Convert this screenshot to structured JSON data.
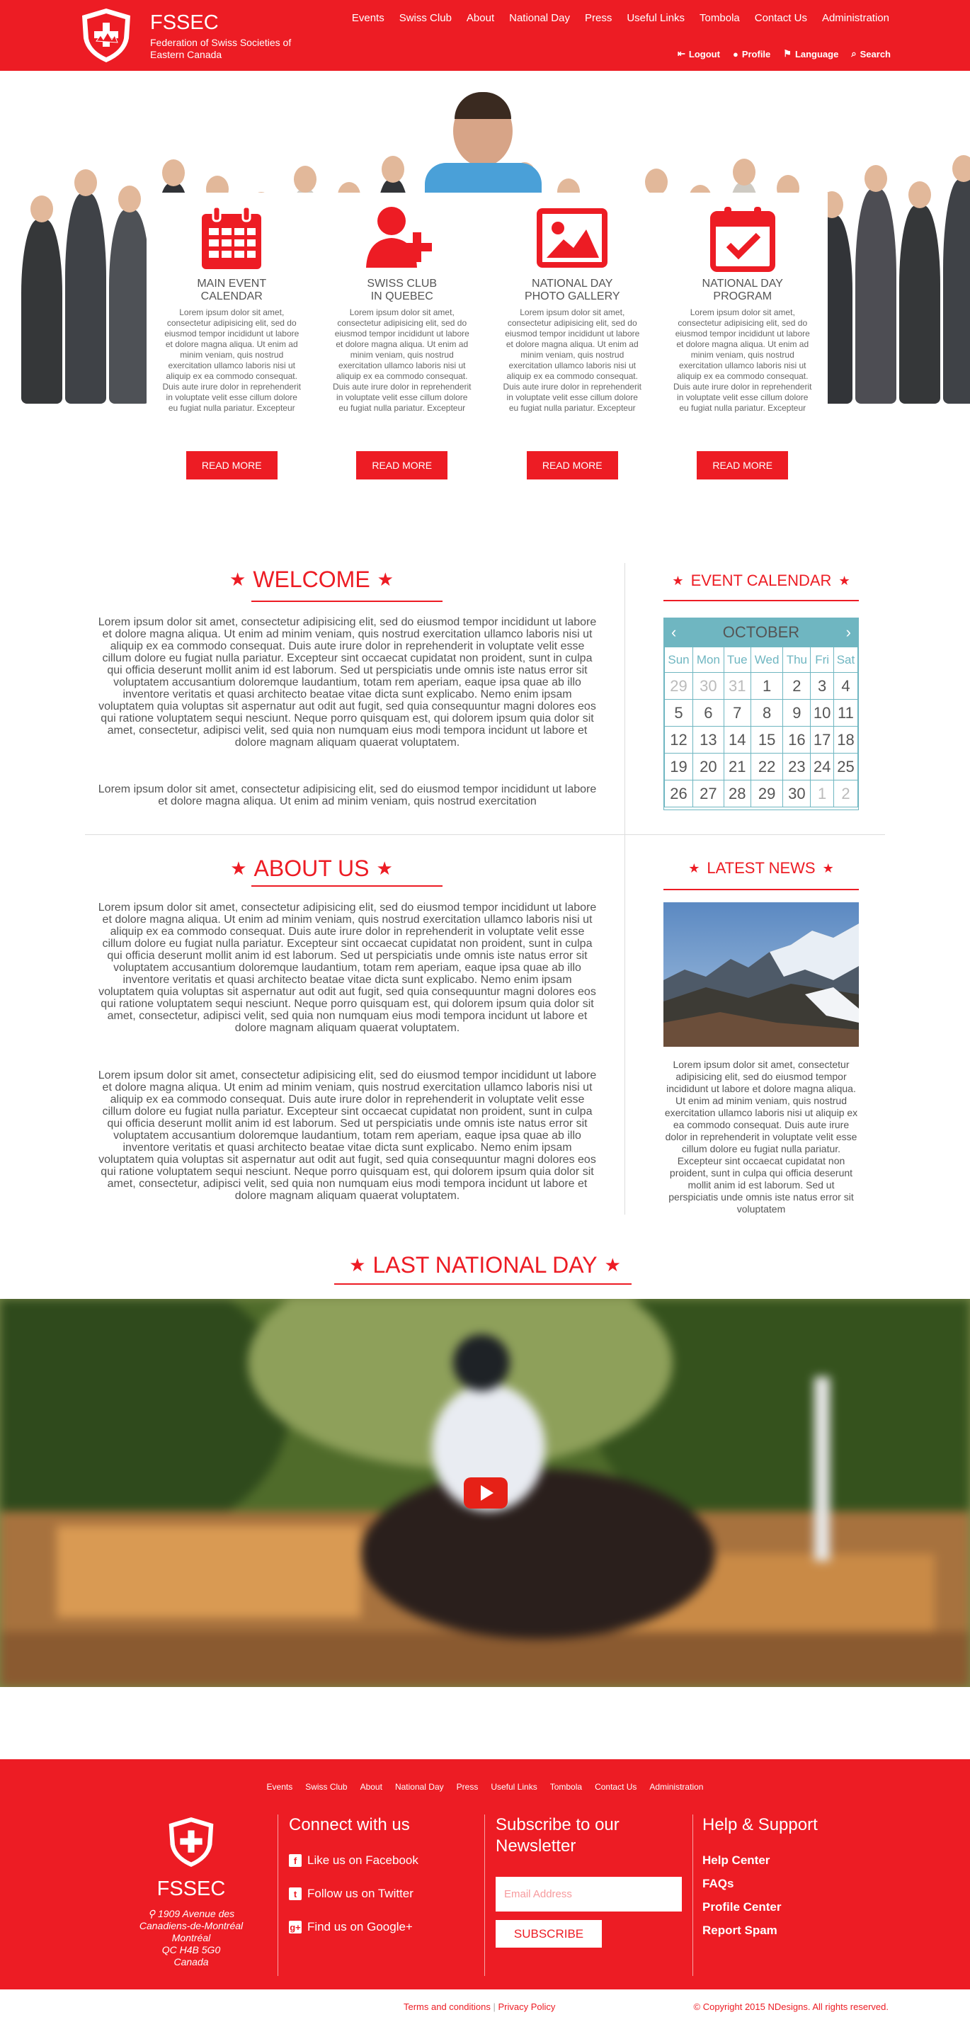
{
  "header": {
    "brand": "FSSEC",
    "subtitle": "Federation of Swiss Societies of Eastern Canada",
    "nav": [
      "Events",
      "Swiss Club",
      "About",
      "National Day",
      "Press",
      "Useful Links",
      "Tombola",
      "Contact Us",
      "Administration"
    ],
    "subnav": [
      {
        "icon": "logout-icon",
        "label": "Logout"
      },
      {
        "icon": "user-icon",
        "label": "Profile"
      },
      {
        "icon": "language-icon",
        "label": "Language"
      },
      {
        "icon": "search-icon",
        "label": "Search"
      }
    ]
  },
  "cards": [
    {
      "icon": "calendar-grid-icon",
      "title_l1": "MAIN EVENT",
      "title_l2": "CALENDAR",
      "text": "Lorem ipsum dolor sit amet, consectetur adipisicing elit, sed do eiusmod tempor incididunt ut labore et dolore magna aliqua. Ut enim ad minim veniam, quis nostrud exercitation ullamco laboris nisi ut aliquip ex ea commodo consequat. Duis aute irure dolor in reprehenderit in voluptate velit esse cillum dolore eu fugiat nulla pariatur. Excepteur",
      "button": "READ MORE"
    },
    {
      "icon": "add-user-icon",
      "title_l1": "SWISS CLUB",
      "title_l2": "IN QUEBEC",
      "text": "Lorem ipsum dolor sit amet, consectetur adipisicing elit, sed do eiusmod tempor incididunt ut labore et dolore magna aliqua. Ut enim ad minim veniam, quis nostrud exercitation ullamco laboris nisi ut aliquip ex ea commodo consequat. Duis aute irure dolor in reprehenderit in voluptate velit esse cillum dolore eu fugiat nulla pariatur. Excepteur",
      "button": "READ MORE"
    },
    {
      "icon": "picture-icon",
      "title_l1": "NATIONAL DAY",
      "title_l2": "PHOTO GALLERY",
      "text": "Lorem ipsum dolor sit amet, consectetur adipisicing elit, sed do eiusmod tempor incididunt ut labore et dolore magna aliqua. Ut enim ad minim veniam, quis nostrud exercitation ullamco laboris nisi ut aliquip ex ea commodo consequat. Duis aute irure dolor in reprehenderit in voluptate velit esse cillum dolore eu fugiat nulla pariatur. Excepteur",
      "button": "READ MORE"
    },
    {
      "icon": "calendar-check-icon",
      "title_l1": "NATIONAL DAY",
      "title_l2": "PROGRAM",
      "text": "Lorem ipsum dolor sit amet, consectetur adipisicing elit, sed do eiusmod tempor incididunt ut labore et dolore magna aliqua. Ut enim ad minim veniam, quis nostrud exercitation ullamco laboris nisi ut aliquip ex ea commodo consequat. Duis aute irure dolor in reprehenderit in voluptate velit esse cillum dolore eu fugiat nulla pariatur. Excepteur",
      "button": "READ MORE"
    }
  ],
  "welcome": {
    "title": "WELCOME",
    "p1": "Lorem ipsum dolor sit amet, consectetur adipisicing elit, sed do eiusmod tempor incididunt ut labore et dolore magna aliqua. Ut enim ad minim veniam, quis nostrud exercitation ullamco laboris nisi ut aliquip ex ea commodo consequat. Duis aute irure dolor in reprehenderit in voluptate velit esse cillum dolore eu fugiat nulla pariatur. Excepteur sint occaecat cupidatat non proident, sunt in culpa qui officia deserunt mollit anim id est laborum. Sed ut perspiciatis unde omnis iste natus error sit voluptatem accusantium doloremque laudantium, totam rem aperiam, eaque ipsa quae ab illo inventore veritatis et quasi architecto beatae vitae dicta sunt explicabo. Nemo enim ipsam voluptatem quia voluptas sit aspernatur aut odit aut fugit, sed quia consequuntur magni dolores eos qui ratione voluptatem sequi nesciunt. Neque porro quisquam est, qui dolorem ipsum quia dolor sit amet, consectetur, adipisci velit, sed quia non numquam eius modi tempora incidunt ut labore et dolore magnam aliquam quaerat voluptatem.",
    "p2": "Lorem ipsum dolor sit amet, consectetur adipisicing elit, sed do eiusmod tempor incididunt ut labore et dolore magna aliqua. Ut enim ad minim veniam, quis nostrud exercitation"
  },
  "calendar": {
    "title": "EVENT CALENDAR",
    "month": "OCTOBER",
    "weekdays": [
      "Sun",
      "Mon",
      "Tue",
      "Wed",
      "Thu",
      "Fri",
      "Sat"
    ],
    "rows": [
      [
        "29",
        "30",
        "31",
        "1",
        "2",
        "3",
        "4"
      ],
      [
        "5",
        "6",
        "7",
        "8",
        "9",
        "10",
        "11"
      ],
      [
        "12",
        "13",
        "14",
        "15",
        "16",
        "17",
        "18"
      ],
      [
        "19",
        "20",
        "21",
        "22",
        "23",
        "24",
        "25"
      ],
      [
        "26",
        "27",
        "28",
        "29",
        "30",
        "1",
        "2"
      ]
    ],
    "muted": [
      [
        0,
        0
      ],
      [
        0,
        1
      ],
      [
        0,
        2
      ],
      [
        4,
        5
      ],
      [
        4,
        6
      ]
    ]
  },
  "about": {
    "title": "ABOUT US",
    "p1": "Lorem ipsum dolor sit amet, consectetur adipisicing elit, sed do eiusmod tempor incididunt ut labore et dolore magna aliqua. Ut enim ad minim veniam, quis nostrud exercitation ullamco laboris nisi ut aliquip ex ea commodo consequat. Duis aute irure dolor in reprehenderit in voluptate velit esse cillum dolore eu fugiat nulla pariatur. Excepteur sint occaecat cupidatat non proident, sunt in culpa qui officia deserunt mollit anim id est laborum. Sed ut perspiciatis unde omnis iste natus error sit voluptatem accusantium doloremque laudantium, totam rem aperiam, eaque ipsa quae ab illo inventore veritatis et quasi architecto beatae vitae dicta sunt explicabo. Nemo enim ipsam voluptatem quia voluptas sit aspernatur aut odit aut fugit, sed quia consequuntur magni dolores eos qui ratione voluptatem sequi nesciunt. Neque porro quisquam est, qui dolorem ipsum quia dolor sit amet, consectetur, adipisci velit, sed quia non numquam eius modi tempora incidunt ut labore et dolore magnam aliquam quaerat voluptatem.",
    "p2": "Lorem ipsum dolor sit amet, consectetur adipisicing elit, sed do eiusmod tempor incididunt ut labore et dolore magna aliqua. Ut enim ad minim veniam, quis nostrud exercitation ullamco laboris nisi ut aliquip ex ea commodo consequat. Duis aute irure dolor in reprehenderit in voluptate velit esse cillum dolore eu fugiat nulla pariatur. Excepteur sint occaecat cupidatat non proident, sunt in culpa qui officia deserunt mollit anim id est laborum. Sed ut perspiciatis unde omnis iste natus error sit voluptatem accusantium doloremque laudantium, totam rem aperiam, eaque ipsa quae ab illo inventore veritatis et quasi architecto beatae vitae dicta sunt explicabo. Nemo enim ipsam voluptatem quia voluptas sit aspernatur aut odit aut fugit, sed quia consequuntur magni dolores eos qui ratione voluptatem sequi nesciunt. Neque porro quisquam est, qui dolorem ipsum quia dolor sit amet, consectetur, adipisci velit, sed quia non numquam eius modi tempora incidunt ut labore et dolore magnam aliquam quaerat voluptatem."
  },
  "news": {
    "title": "LATEST NEWS",
    "text": "Lorem ipsum dolor sit amet, consectetur adipisicing elit, sed do eiusmod tempor incididunt ut labore et dolore magna aliqua. Ut enim ad minim veniam, quis nostrud exercitation ullamco laboris nisi ut aliquip ex ea commodo consequat. Duis aute irure dolor in reprehenderit in voluptate velit esse cillum dolore eu fugiat nulla pariatur. Excepteur sint occaecat cupidatat non proident, sunt in culpa qui officia deserunt mollit anim id est laborum. Sed ut perspiciatis unde omnis iste natus error sit voluptatem"
  },
  "national_day": {
    "title": "LAST NATIONAL DAY"
  },
  "footer": {
    "nav": [
      "Events",
      "Swiss Club",
      "About",
      "National Day",
      "Press",
      "Useful Links",
      "Tombola",
      "Contact Us",
      "Administration"
    ],
    "brand": "FSSEC",
    "address": [
      "1909 Avenue des",
      "Canadiens-de-Montréal",
      "Montréal",
      "QC H4B 5G0",
      "Canada"
    ],
    "connect_title": "Connect with us",
    "social": [
      {
        "icon": "facebook-icon",
        "glyph": "f",
        "label": "Like us on Facebook"
      },
      {
        "icon": "twitter-icon",
        "glyph": "t",
        "label": "Follow us on Twitter"
      },
      {
        "icon": "google-plus-icon",
        "glyph": "g+",
        "label": "Find us on Google+"
      }
    ],
    "newsletter_title": "Subscribe to our Newsletter",
    "email_placeholder": "Email Address",
    "subscribe": "SUBSCRIBE",
    "help_title": "Help & Support",
    "help_links": [
      "Help Center",
      "FAQs",
      "Profile Center",
      "Report Spam"
    ]
  },
  "bottom": {
    "terms": "Terms and conditions",
    "sep": "|",
    "privacy": "Privacy Policy",
    "copyright": "© Copyright 2015 NDesigns. All rights reserved."
  },
  "colors": {
    "accent": "#ed1c24",
    "calendar": "#6fb6c1"
  }
}
